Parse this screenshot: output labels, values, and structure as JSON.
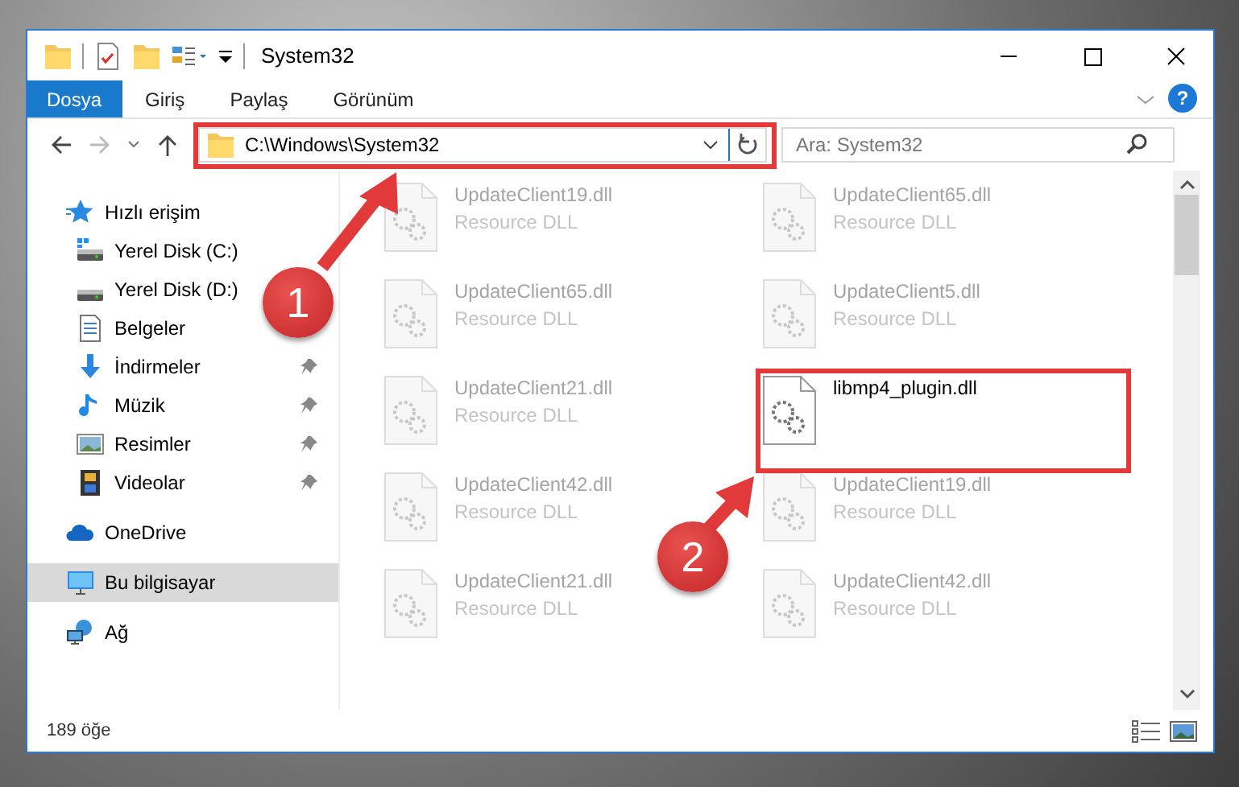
{
  "window": {
    "title": "System32"
  },
  "ribbon": {
    "tabs": [
      {
        "label": "Dosya",
        "selected": true
      },
      {
        "label": "Giriş",
        "selected": false
      },
      {
        "label": "Paylaş",
        "selected": false
      },
      {
        "label": "Görünüm",
        "selected": false
      }
    ],
    "help": "?"
  },
  "address_bar": {
    "path": "C:\\Windows\\System32"
  },
  "search": {
    "placeholder": "Ara: System32"
  },
  "sidebar": {
    "items": [
      {
        "label": "Hızlı erişim",
        "kind": "quick-access",
        "selected": false,
        "children": [
          {
            "label": "Yerel Disk (C:)",
            "kind": "system-drive",
            "selected": false,
            "pinned": false
          },
          {
            "label": "Yerel Disk (D:)",
            "kind": "drive",
            "selected": false,
            "pinned": false
          },
          {
            "label": "Belgeler",
            "kind": "documents",
            "selected": false,
            "pinned": false
          },
          {
            "label": "İndirmeler",
            "kind": "downloads",
            "selected": false,
            "pinned": true
          },
          {
            "label": "Müzik",
            "kind": "music",
            "selected": false,
            "pinned": true
          },
          {
            "label": "Resimler",
            "kind": "pictures",
            "selected": false,
            "pinned": true
          },
          {
            "label": "Videolar",
            "kind": "videos",
            "selected": false,
            "pinned": true
          }
        ]
      },
      {
        "label": "OneDrive",
        "kind": "onedrive",
        "selected": false
      },
      {
        "label": "Bu bilgisayar",
        "kind": "computer",
        "selected": true
      },
      {
        "label": "Ağ",
        "kind": "network",
        "selected": false
      }
    ]
  },
  "files": [
    {
      "name": "UpdateClient19.dll",
      "type": "Resource DLL",
      "blurred": true
    },
    {
      "name": "UpdateClient65.dll",
      "type": "Resource DLL",
      "blurred": true
    },
    {
      "name": "UpdateClient65.dll",
      "type": "Resource DLL",
      "blurred": true
    },
    {
      "name": "UpdateClient5.dll",
      "type": "Resource DLL",
      "blurred": true
    },
    {
      "name": "UpdateClient21.dll",
      "type": "Resource DLL",
      "blurred": true
    },
    {
      "name": "libmp4_plugin.dll",
      "blurred": false
    },
    {
      "name": "UpdateClient42.dll",
      "type": "Resource DLL",
      "blurred": true
    },
    {
      "name": "UpdateClient19.dll",
      "type": "Resource DLL",
      "blurred": true
    },
    {
      "name": "UpdateClient21.dll",
      "type": "Resource DLL",
      "blurred": true
    },
    {
      "name": "UpdateClient42.dll",
      "type": "Resource DLL",
      "blurred": true
    }
  ],
  "status_bar": {
    "item_count": "189 öğe"
  },
  "callouts": [
    {
      "number": "1"
    },
    {
      "number": "2"
    }
  ]
}
